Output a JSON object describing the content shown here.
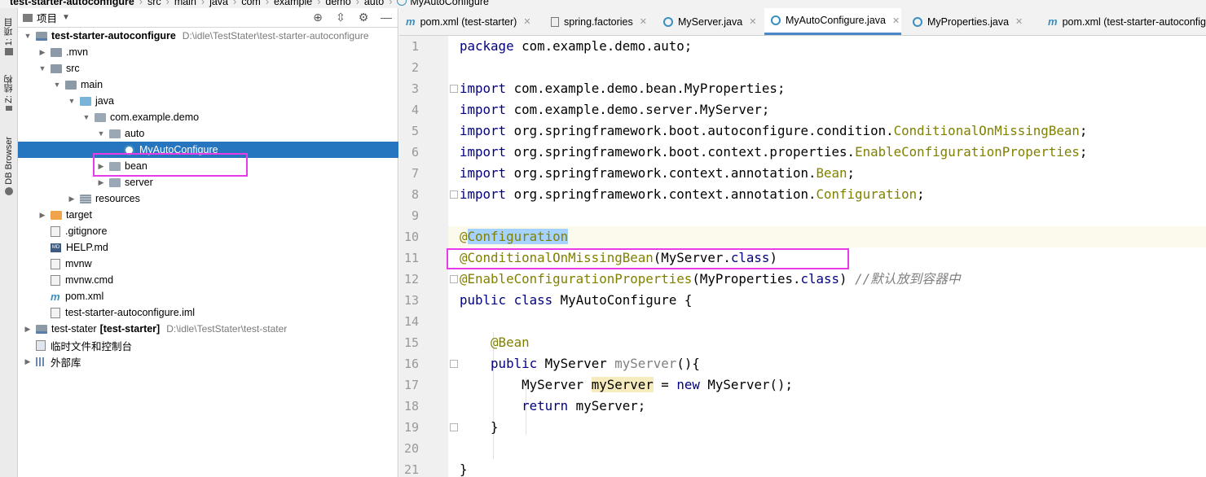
{
  "breadcrumb": {
    "items": [
      "test-starter-autoconfigure",
      "src",
      "main",
      "java",
      "com",
      "example",
      "demo",
      "auto",
      "MyAutoConfigure"
    ]
  },
  "left_stripe": {
    "buttons": [
      "1: 项目",
      "Z: 结构",
      "DB Browser"
    ]
  },
  "project_panel": {
    "title": "项目",
    "tools": [
      "crosshair-icon",
      "collapse-icon",
      "gear-icon",
      "minimize-icon"
    ],
    "tree": [
      {
        "label": "test-starter-autoconfigure",
        "path": "D:\\idle\\TestStater\\test-starter-autoconfigure",
        "depth": 0,
        "arrow": "down",
        "icon": "module-folder",
        "bold": true
      },
      {
        "label": ".mvn",
        "depth": 1,
        "arrow": "right",
        "icon": "folder"
      },
      {
        "label": "src",
        "depth": 1,
        "arrow": "down",
        "icon": "folder"
      },
      {
        "label": "main",
        "depth": 2,
        "arrow": "down",
        "icon": "folder"
      },
      {
        "label": "java",
        "depth": 3,
        "arrow": "down",
        "icon": "folder-blue"
      },
      {
        "label": "com.example.demo",
        "depth": 4,
        "arrow": "down",
        "icon": "package"
      },
      {
        "label": "auto",
        "depth": 5,
        "arrow": "down",
        "icon": "package"
      },
      {
        "label": "MyAutoConfigure",
        "depth": 6,
        "arrow": "",
        "icon": "class",
        "selected": true
      },
      {
        "label": "bean",
        "depth": 5,
        "arrow": "right",
        "icon": "package"
      },
      {
        "label": "server",
        "depth": 5,
        "arrow": "right",
        "icon": "package"
      },
      {
        "label": "resources",
        "depth": 3,
        "arrow": "right",
        "icon": "resources-folder"
      },
      {
        "label": "target",
        "depth": 1,
        "arrow": "right",
        "icon": "folder-orange"
      },
      {
        "label": ".gitignore",
        "depth": 1,
        "arrow": "",
        "icon": "file"
      },
      {
        "label": "HELP.md",
        "depth": 1,
        "arrow": "",
        "icon": "md"
      },
      {
        "label": "mvnw",
        "depth": 1,
        "arrow": "",
        "icon": "file"
      },
      {
        "label": "mvnw.cmd",
        "depth": 1,
        "arrow": "",
        "icon": "file"
      },
      {
        "label": "pom.xml",
        "depth": 1,
        "arrow": "",
        "icon": "maven"
      },
      {
        "label": "test-starter-autoconfigure.iml",
        "depth": 1,
        "arrow": "",
        "icon": "file"
      },
      {
        "label": "test-stater",
        "label_bold": "[test-starter]",
        "path": "D:\\idle\\TestStater\\test-stater",
        "depth": 0,
        "arrow": "right",
        "icon": "module-folder"
      },
      {
        "label": "临时文件和控制台",
        "depth": 0,
        "arrow": "",
        "icon": "scratch"
      },
      {
        "label": "外部库",
        "depth": 0,
        "arrow": "right",
        "icon": "library"
      }
    ]
  },
  "tabs": [
    {
      "label": "pom.xml (test-starter)",
      "icon": "maven",
      "active": false
    },
    {
      "label": "spring.factories",
      "icon": "file",
      "active": false
    },
    {
      "label": "MyServer.java",
      "icon": "class",
      "active": false
    },
    {
      "label": "MyAutoConfigure.java",
      "icon": "class",
      "active": true
    },
    {
      "label": "MyProperties.java",
      "icon": "class",
      "active": false
    },
    {
      "label": "pom.xml (test-starter-autoconfigure)",
      "icon": "maven",
      "active": false
    }
  ],
  "editor": {
    "lines": [
      {
        "n": "1",
        "code": "package com.example.demo.auto;"
      },
      {
        "n": "2",
        "code": ""
      },
      {
        "n": "3",
        "code": "import com.example.demo.bean.MyProperties;"
      },
      {
        "n": "4",
        "code": "import com.example.demo.server.MyServer;"
      },
      {
        "n": "5",
        "code": "import org.springframework.boot.autoconfigure.condition.ConditionalOnMissingBean;"
      },
      {
        "n": "6",
        "code": "import org.springframework.boot.context.properties.EnableConfigurationProperties;"
      },
      {
        "n": "7",
        "code": "import org.springframework.context.annotation.Bean;"
      },
      {
        "n": "8",
        "code": "import org.springframework.context.annotation.Configuration;"
      },
      {
        "n": "9",
        "code": ""
      },
      {
        "n": "10",
        "code": "@Configuration"
      },
      {
        "n": "11",
        "code": "@ConditionalOnMissingBean(MyServer.class)"
      },
      {
        "n": "12",
        "code": "@EnableConfigurationProperties(MyProperties.class) //默认放到容器中"
      },
      {
        "n": "13",
        "code": "public class MyAutoConfigure {"
      },
      {
        "n": "14",
        "code": ""
      },
      {
        "n": "15",
        "code": "    @Bean"
      },
      {
        "n": "16",
        "code": "    public MyServer myServer(){"
      },
      {
        "n": "17",
        "code": "        MyServer myServer = new MyServer();"
      },
      {
        "n": "18",
        "code": "        return myServer;"
      },
      {
        "n": "19",
        "code": "    }"
      },
      {
        "n": "20",
        "code": ""
      },
      {
        "n": "21",
        "code": "}"
      }
    ]
  },
  "colors": {
    "selection": "#2675bf",
    "keyword": "#000080",
    "annotation": "#808000",
    "highlight_box": "#e93ae9",
    "active_tab_underline": "#4a88c7"
  }
}
